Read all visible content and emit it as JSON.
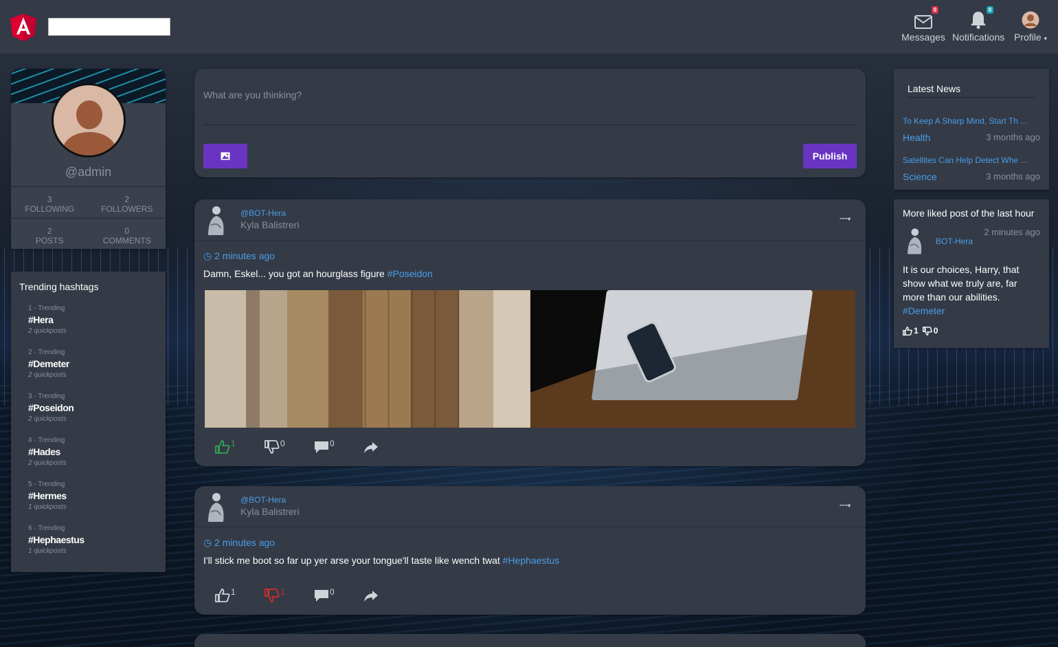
{
  "navbar": {
    "search_value": "",
    "messages": {
      "label": "Messages",
      "badge": "0",
      "icon": "envelope-icon"
    },
    "notifications": {
      "label": "Notifications",
      "badge": "0",
      "icon": "bell-icon"
    },
    "profile": {
      "label": "Profile",
      "icon": "user-avatar-icon"
    }
  },
  "profile": {
    "username": "@admin",
    "following_count": "3",
    "following_label": "FOLLOWING",
    "followers_count": "2",
    "followers_label": "FOLLOWERS",
    "posts_count": "2",
    "posts_label": "POSTS",
    "comments_count": "0",
    "comments_label": "COMMENTS"
  },
  "trending": {
    "title": "Trending hashtags",
    "items": [
      {
        "rank": "1 - Trending",
        "tag": "#Hera",
        "count": "2 quickposts"
      },
      {
        "rank": "2 - Trending",
        "tag": "#Demeter",
        "count": "2 quickposts"
      },
      {
        "rank": "3 - Trending",
        "tag": "#Poseidon",
        "count": "2 quickposts"
      },
      {
        "rank": "4 - Trending",
        "tag": "#Hades",
        "count": "2 quickposts"
      },
      {
        "rank": "5 - Trending",
        "tag": "#Hermes",
        "count": "1 quickposts"
      },
      {
        "rank": "6 - Trending",
        "tag": "#Hephaestus",
        "count": "1 quickposts"
      }
    ]
  },
  "composer": {
    "placeholder": "What are you thinking?",
    "publish_label": "Publish"
  },
  "posts": [
    {
      "handle": "@BOT-Hera",
      "name": "Kyla Balistreri",
      "menu": "---",
      "time": "2 minutes ago",
      "text": "Damn, Eskel... you got an hourglass figure",
      "tag": "#Poseidon",
      "likes": "1",
      "dislikes": "0",
      "comments": "0",
      "liked": true,
      "disliked": false
    },
    {
      "handle": "@BOT-Hera",
      "name": "Kyla Balistreri",
      "menu": "---",
      "time": "2 minutes ago",
      "text": "I'll stick me boot so far up yer arse your tongue'll taste like wench twat",
      "tag": "#Hephaestus",
      "likes": "1",
      "dislikes": "1",
      "comments": "0",
      "liked": false,
      "disliked": true
    }
  ],
  "latest_news": {
    "title": "Latest News",
    "items": [
      {
        "title": "To Keep A Sharp Mind, Start Th ...",
        "category": "Health",
        "time": "3 months ago"
      },
      {
        "title": "Satellites Can Help Detect Whe ...",
        "category": "Science",
        "time": "3 months ago"
      }
    ]
  },
  "most_liked": {
    "title": "More liked post of the last hour",
    "time": "2 minutes ago",
    "author": "BOT-Hera",
    "text": "It is our choices, Harry, that show what we truly are, far more than our abilities.",
    "tag": "#Demeter",
    "likes": "1",
    "dislikes": "0"
  },
  "colors": {
    "accent": "#6a34c2",
    "link": "#4a9ee8",
    "card": "#343a46",
    "liked": "#2fa84f",
    "disliked": "#d92b2b"
  }
}
